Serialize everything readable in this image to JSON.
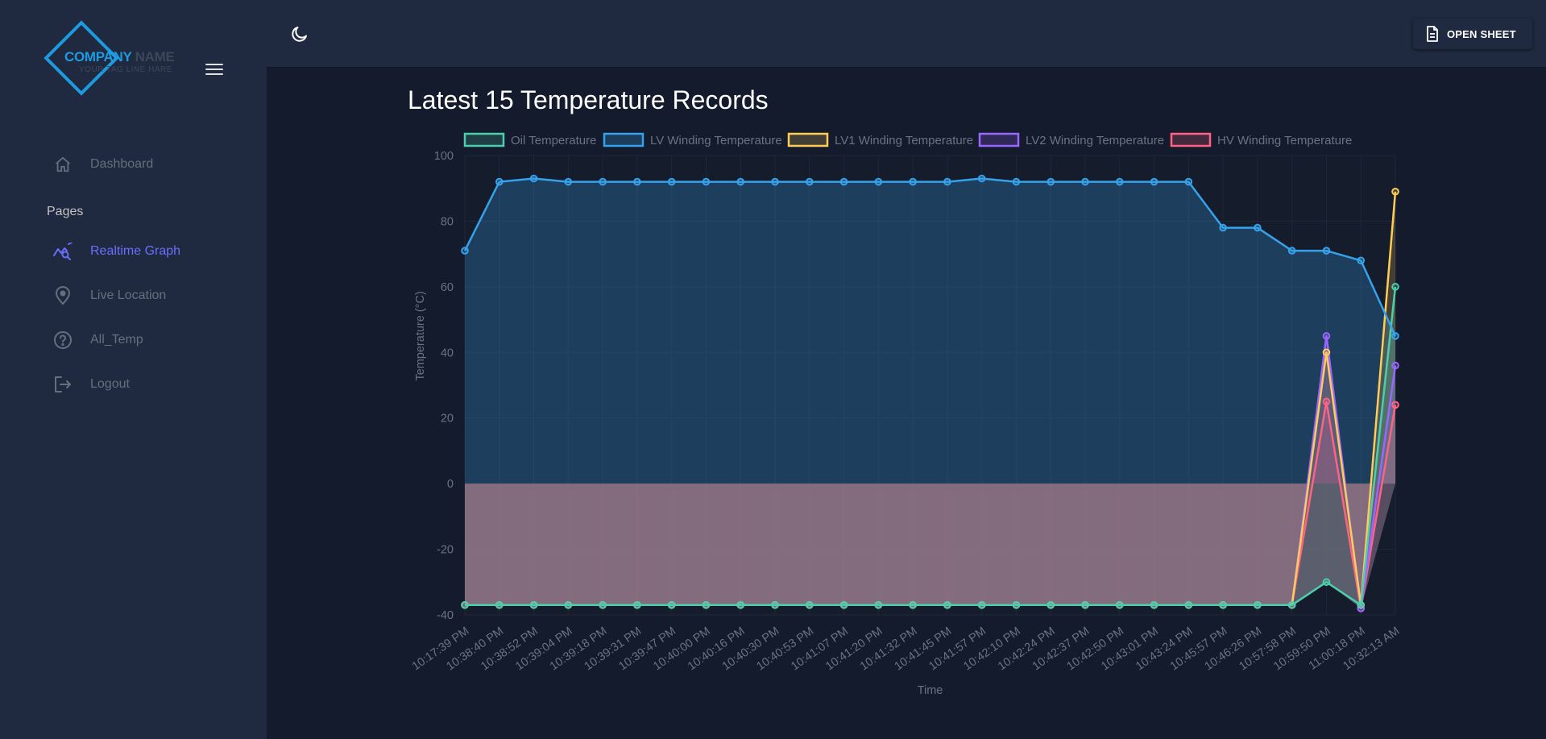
{
  "brand": {
    "name_part1": "COMPANY",
    "name_part2": "NAME",
    "tagline": "YOUR TAG LINE HARE",
    "accent_color": "#1e9be0"
  },
  "sidebar": {
    "section_label": "Pages",
    "items": [
      {
        "label": "Dashboard",
        "icon": "home-icon",
        "active": false
      },
      {
        "label": "Realtime Graph",
        "icon": "graph-search-icon",
        "active": true
      },
      {
        "label": "Live Location",
        "icon": "location-pin-icon",
        "active": false
      },
      {
        "label": "All_Temp",
        "icon": "help-circle-icon",
        "active": false
      },
      {
        "label": "Logout",
        "icon": "logout-icon",
        "active": false
      }
    ],
    "active_color": "#6870fa"
  },
  "topbar": {
    "theme_icon": "moon-icon",
    "open_sheet_label": "OPEN SHEET",
    "open_sheet_icon": "document-icon"
  },
  "page": {
    "title": "Latest 15 Temperature Records"
  },
  "chart_data": {
    "type": "line",
    "xlabel": "Time",
    "ylabel": "Temperature (°C)",
    "ylim": [
      -40,
      100
    ],
    "yticks": [
      100,
      80,
      60,
      40,
      20,
      0,
      -20,
      -40
    ],
    "grid": true,
    "legend_position": "top",
    "x": [
      "10:17:39 PM",
      "10:38:40 PM",
      "10:38:52 PM",
      "10:39:04 PM",
      "10:39:18 PM",
      "10:39:31 PM",
      "10:39:47 PM",
      "10:40:00 PM",
      "10:40:16 PM",
      "10:40:30 PM",
      "10:40:53 PM",
      "10:41:07 PM",
      "10:41:20 PM",
      "10:41:32 PM",
      "10:41:45 PM",
      "10:41:57 PM",
      "10:42:10 PM",
      "10:42:24 PM",
      "10:42:37 PM",
      "10:42:50 PM",
      "10:43:01 PM",
      "10:43:24 PM",
      "10:45:57 PM",
      "10:46:26 PM",
      "10:57:58 PM",
      "10:59:50 PM",
      "11:00:18 PM",
      "10:32:13 AM"
    ],
    "series": [
      {
        "name": "Oil Temperature",
        "color": "#4cceac",
        "fill": "rgba(76,206,172,0.20)",
        "values": [
          -37,
          -37,
          -37,
          -37,
          -37,
          -37,
          -37,
          -37,
          -37,
          -37,
          -37,
          -37,
          -37,
          -37,
          -37,
          -37,
          -37,
          -37,
          -37,
          -37,
          -37,
          -37,
          -37,
          -37,
          -37,
          -30,
          -37,
          60
        ]
      },
      {
        "name": "LV Winding Temperature",
        "color": "#36a2eb",
        "fill": "rgba(54,162,235,0.25)",
        "values": [
          71,
          92,
          93,
          92,
          92,
          92,
          92,
          92,
          92,
          92,
          92,
          92,
          92,
          92,
          92,
          93,
          92,
          92,
          92,
          92,
          92,
          92,
          78,
          78,
          71,
          71,
          68,
          45
        ]
      },
      {
        "name": "LV1 Winding Temperature",
        "color": "#ffcd56",
        "fill": "rgba(255,205,86,0.20)",
        "values": [
          -37,
          -37,
          -37,
          -37,
          -37,
          -37,
          -37,
          -37,
          -37,
          -37,
          -37,
          -37,
          -37,
          -37,
          -37,
          -37,
          -37,
          -37,
          -37,
          -37,
          -37,
          -37,
          -37,
          -37,
          -37,
          40,
          -37,
          89
        ]
      },
      {
        "name": "LV2 Winding Temperature",
        "color": "#9966ff",
        "fill": "rgba(153,102,255,0.20)",
        "values": [
          -37,
          -37,
          -37,
          -37,
          -37,
          -37,
          -37,
          -37,
          -37,
          -37,
          -37,
          -37,
          -37,
          -37,
          -37,
          -37,
          -37,
          -37,
          -37,
          -37,
          -37,
          -37,
          -37,
          -37,
          -37,
          45,
          -38,
          36
        ]
      },
      {
        "name": "HV Winding Temperature",
        "color": "#ff6384",
        "fill": "rgba(255,99,132,0.20)",
        "values": [
          -37,
          -37,
          -37,
          -37,
          -37,
          -37,
          -37,
          -37,
          -37,
          -37,
          -37,
          -37,
          -37,
          -37,
          -37,
          -37,
          -37,
          -37,
          -37,
          -37,
          -37,
          -37,
          -37,
          -37,
          -37,
          25,
          -38,
          24
        ]
      }
    ]
  }
}
